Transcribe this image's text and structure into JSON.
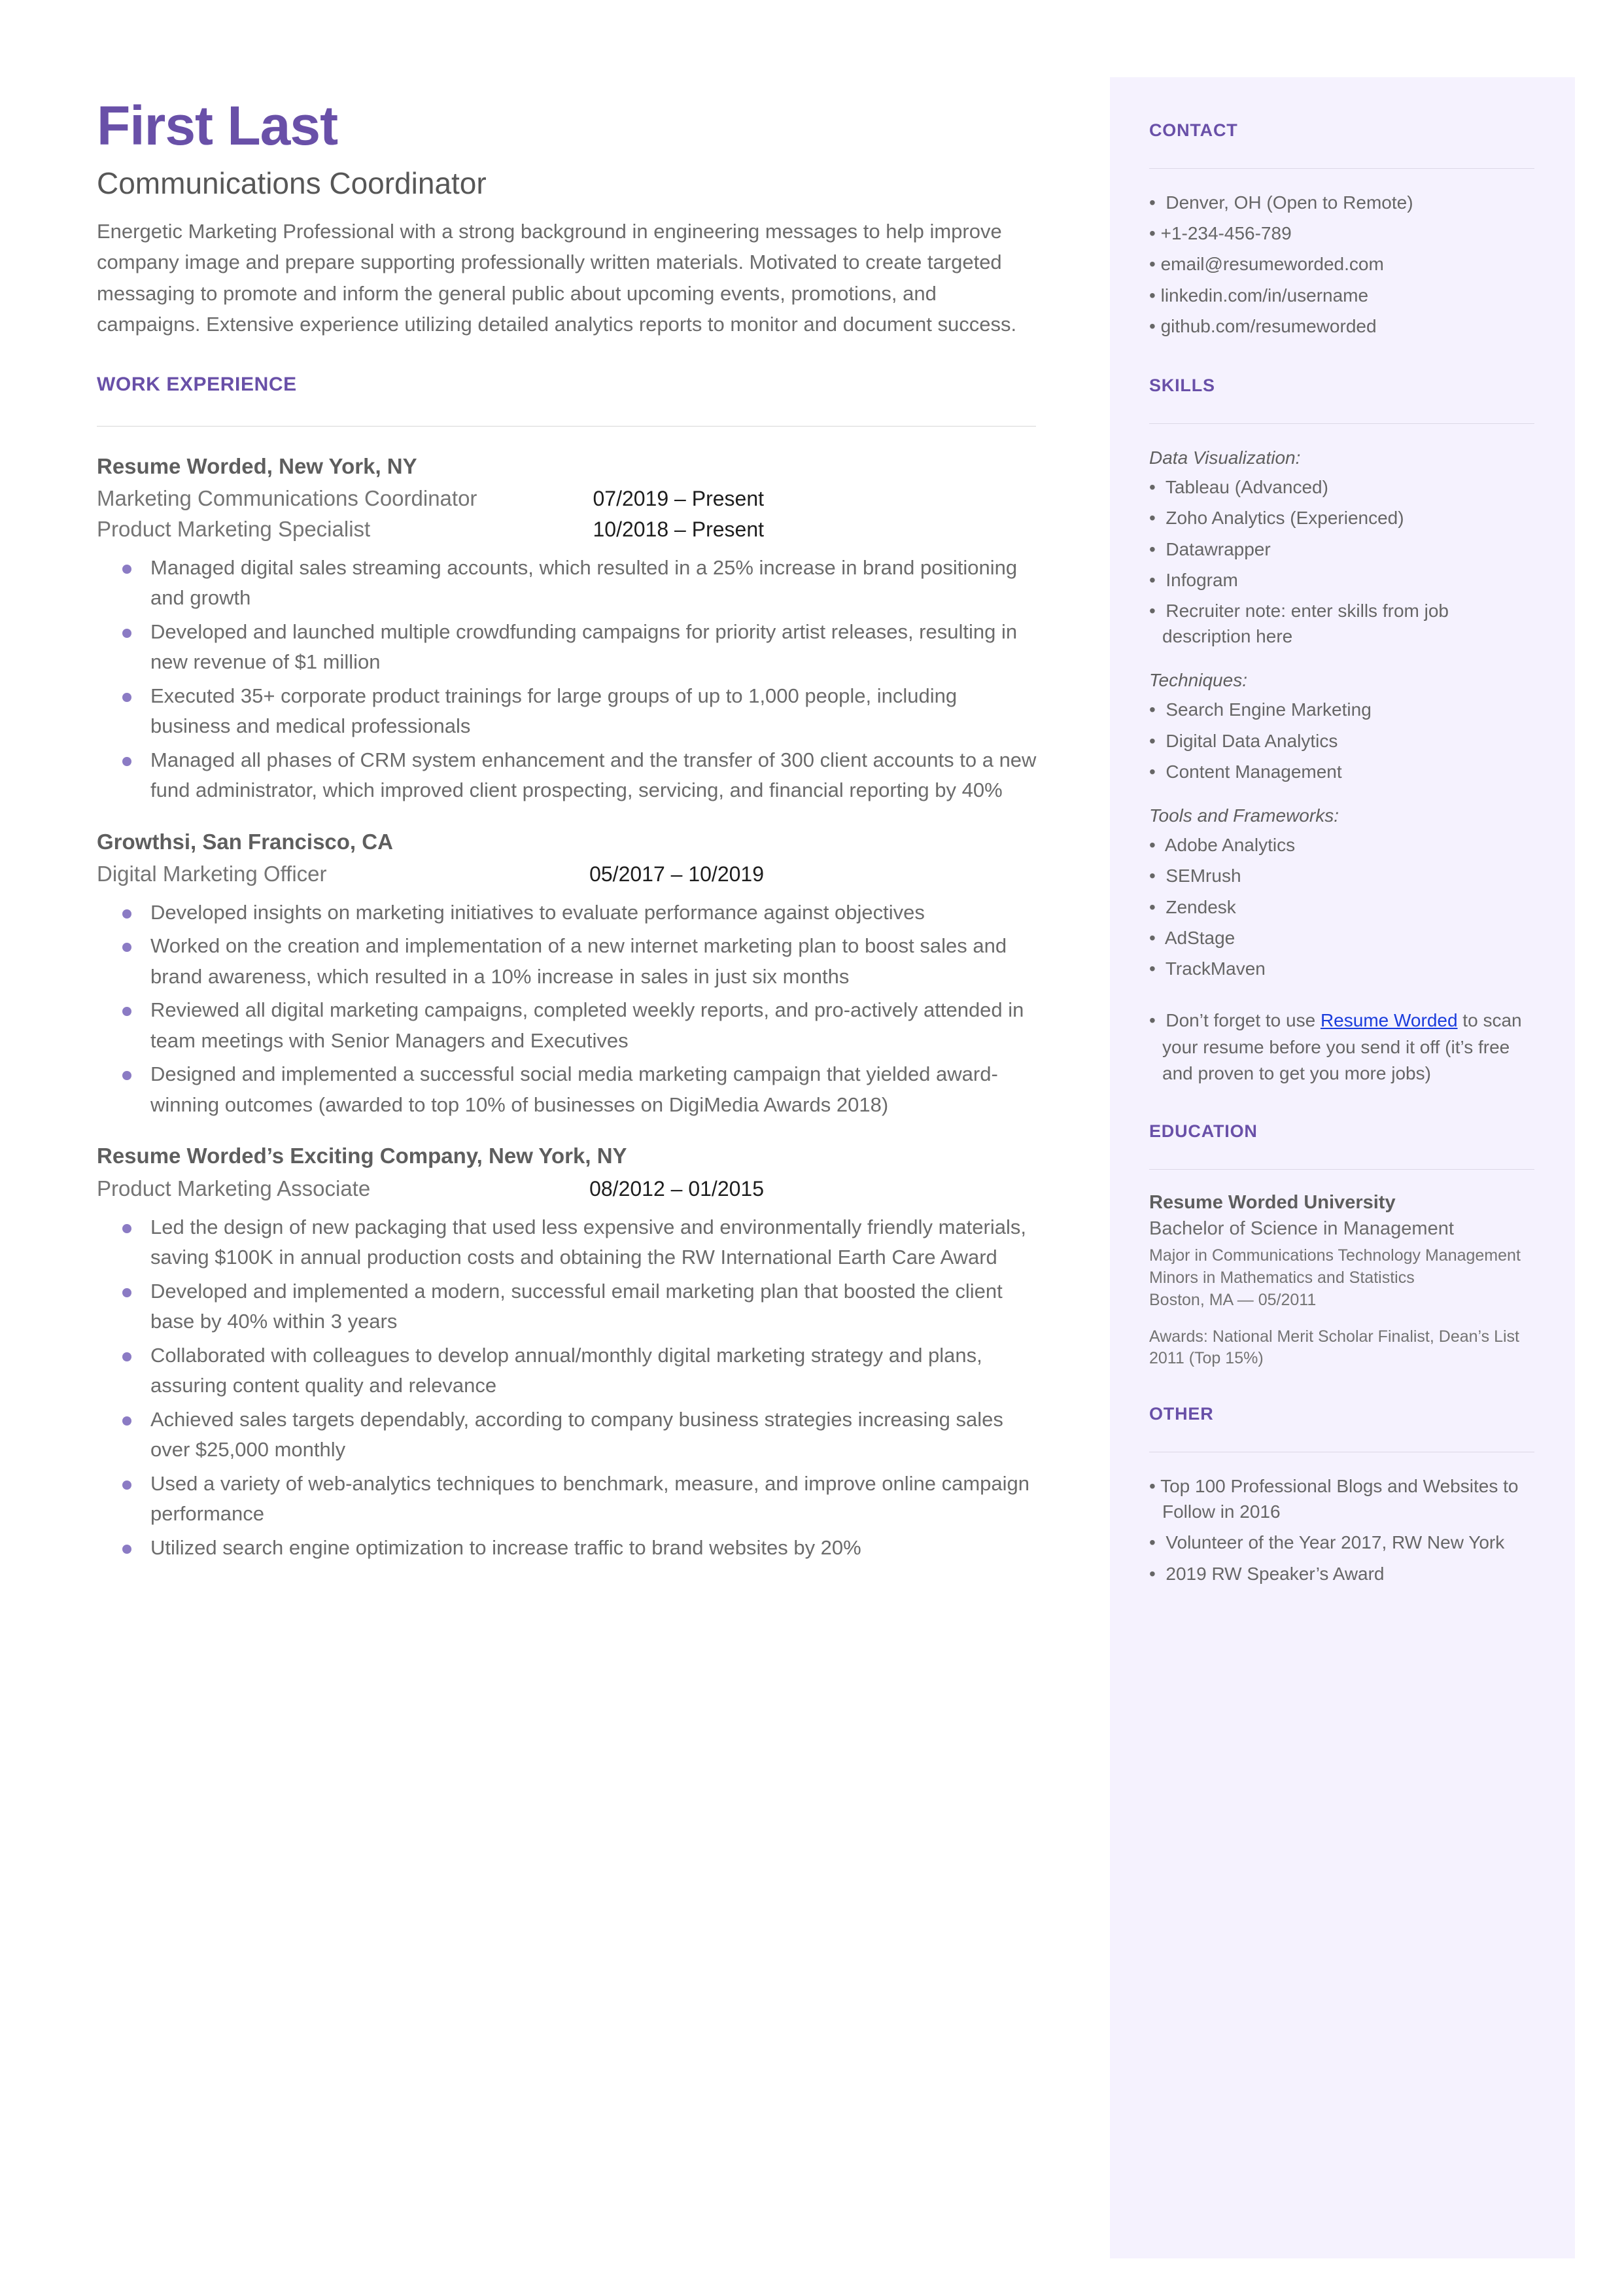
{
  "theme": {
    "accent": "#6950a8",
    "bullet": "#8b7bc4",
    "sidebar_bg": "#f5f2fe",
    "body_text": "#6b6b6b",
    "link": "#1a3cdc"
  },
  "header": {
    "name": "First Last",
    "title": "Communications Coordinator",
    "summary": "Energetic Marketing Professional with a strong background in engineering messages to help improve company image and prepare supporting professionally written materials. Motivated to create targeted messaging to promote and inform the general public about upcoming events, promotions, and campaigns. Extensive experience utilizing detailed analytics reports to monitor and document success."
  },
  "work_experience": {
    "heading": "WORK EXPERIENCE",
    "jobs": [
      {
        "company": "Resume Worded, New York, NY",
        "roles": [
          {
            "title": "Marketing Communications Coordinator",
            "dates": "07/2019 – Present"
          },
          {
            "title": "Product Marketing Specialist",
            "dates": "10/2018 – Present"
          }
        ],
        "bullets": [
          "Managed digital sales streaming accounts, which resulted in a 25% increase in brand positioning and growth",
          "Developed and launched multiple crowdfunding campaigns for priority artist releases, resulting in new revenue of $1 million",
          "Executed 35+ corporate product trainings for large groups of up to 1,000 people, including business and medical professionals",
          "Managed all phases of CRM system enhancement and the transfer of 300 client accounts to a new fund administrator, which improved client prospecting, servicing, and financial reporting by 40%"
        ]
      },
      {
        "company": "Growthsi, San Francisco, CA",
        "roles": [
          {
            "title": "Digital Marketing Officer",
            "dates": "05/2017 – 10/2019"
          }
        ],
        "bullets": [
          "Developed insights on marketing initiatives to evaluate performance against objectives",
          "Worked on the creation and implementation of a new internet marketing plan to boost sales and brand awareness, which resulted in a 10% increase in sales in just six months",
          "Reviewed all digital marketing campaigns, completed weekly reports, and pro-actively attended in team meetings with Senior Managers and Executives",
          "Designed and implemented a successful social media marketing campaign that yielded award-winning outcomes (awarded to top 10% of businesses on DigiMedia Awards 2018)"
        ]
      },
      {
        "company": "Resume Worded’s Exciting Company, New York, NY",
        "roles": [
          {
            "title": "Product Marketing Associate",
            "dates": "08/2012 – 01/2015"
          }
        ],
        "bullets": [
          "Led the design of new packaging that used less expensive and environmentally friendly materials, saving $100K in annual production costs and obtaining the RW International Earth Care Award",
          "Developed and implemented a modern, successful email marketing plan that boosted the client base by 40% within 3 years",
          "Collaborated with colleagues to develop annual/monthly digital marketing strategy and plans, assuring content quality and relevance",
          "Achieved sales targets dependably, according to company business strategies increasing sales over $25,000 monthly",
          "Used a variety of web-analytics techniques to benchmark, measure, and improve online campaign performance",
          "Utilized search engine optimization to increase traffic to brand websites by 20%"
        ]
      }
    ]
  },
  "contact": {
    "heading": "CONTACT",
    "items": [
      "Denver, OH (Open to Remote)",
      "+1-234-456-789",
      "email@resumeworded.com",
      "linkedin.com/in/username",
      "github.com/resumeworded"
    ]
  },
  "skills": {
    "heading": "SKILLS",
    "groups": [
      {
        "label": "Data Visualization:",
        "items": [
          "Tableau (Advanced)",
          "Zoho Analytics (Experienced)",
          "Datawrapper",
          "Infogram",
          "Recruiter note: enter skills from job description here"
        ]
      },
      {
        "label": "Techniques:",
        "items": [
          "Search Engine Marketing",
          "Digital Data Analytics",
          "Content Management"
        ]
      },
      {
        "label": "Tools and Frameworks:",
        "items": [
          "Adobe Analytics",
          "SEMrush",
          "Zendesk",
          "AdStage",
          "TrackMaven"
        ]
      }
    ],
    "note": {
      "before": "Don’t forget to use ",
      "link": "Resume Worded",
      "after": " to scan your resume before you send it off (it’s free and proven to get you more jobs)"
    }
  },
  "education": {
    "heading": "EDUCATION",
    "school": "Resume Worded University",
    "degree": "Bachelor of Science in Management",
    "details": [
      "Major in Communications Technology Management",
      "Minors in Mathematics and Statistics",
      "Boston, MA — 05/2011"
    ],
    "awards": "Awards: National Merit Scholar Finalist, Dean’s List 2011 (Top 15%)"
  },
  "other": {
    "heading": "OTHER",
    "items": [
      "Top 100 Professional Blogs and Websites to Follow in 2016",
      "Volunteer of the Year 2017, RW New York",
      "2019 RW Speaker’s Award"
    ]
  }
}
